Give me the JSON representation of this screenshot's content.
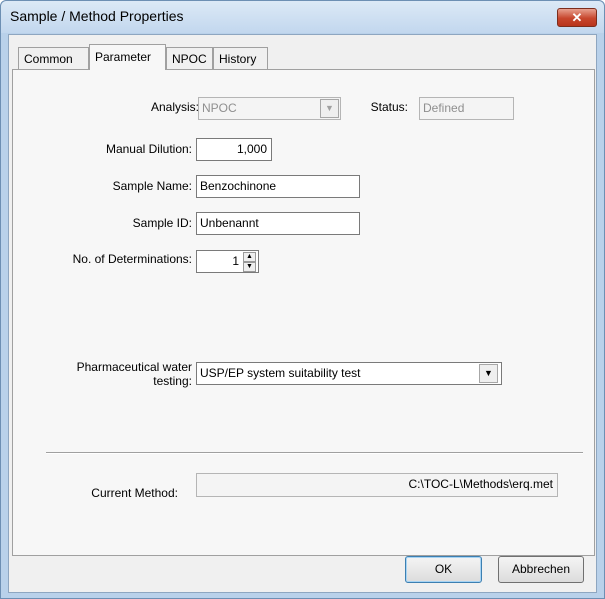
{
  "window": {
    "title": "Sample / Method Properties",
    "close_glyph": "✕"
  },
  "tabs": [
    {
      "label": "Common",
      "active": false
    },
    {
      "label": "Parameter",
      "active": true
    },
    {
      "label": "NPOC",
      "active": false
    },
    {
      "label": "History",
      "active": false
    }
  ],
  "form": {
    "analysis": {
      "label": "Analysis:",
      "value": "NPOC"
    },
    "status": {
      "label": "Status:",
      "value": "Defined"
    },
    "manual_dilution": {
      "label": "Manual Dilution:",
      "value": "1,000"
    },
    "sample_name": {
      "label": "Sample Name:",
      "value": "Benzochinone"
    },
    "sample_id": {
      "label": "Sample ID:",
      "value": "Unbenannt"
    },
    "determinations": {
      "label": "No. of Determinations:",
      "value": "1"
    },
    "pharma": {
      "label_line1": "Pharmaceutical water",
      "label_line2": "testing:",
      "value": "USP/EP system suitability test"
    },
    "current_method": {
      "label": "Current Method:",
      "value": "C:\\TOC-L\\Methods\\erq.met"
    }
  },
  "buttons": {
    "ok": "OK",
    "cancel": "Abbrechen"
  },
  "icons": {
    "dropdown": "chevron-down-icon",
    "spin_up": "triangle-up-icon",
    "spin_down": "triangle-down-icon"
  },
  "colors": {
    "titlebar": "#c2d7ee",
    "close": "#c7462d",
    "dialog": "#f0f0f0"
  }
}
